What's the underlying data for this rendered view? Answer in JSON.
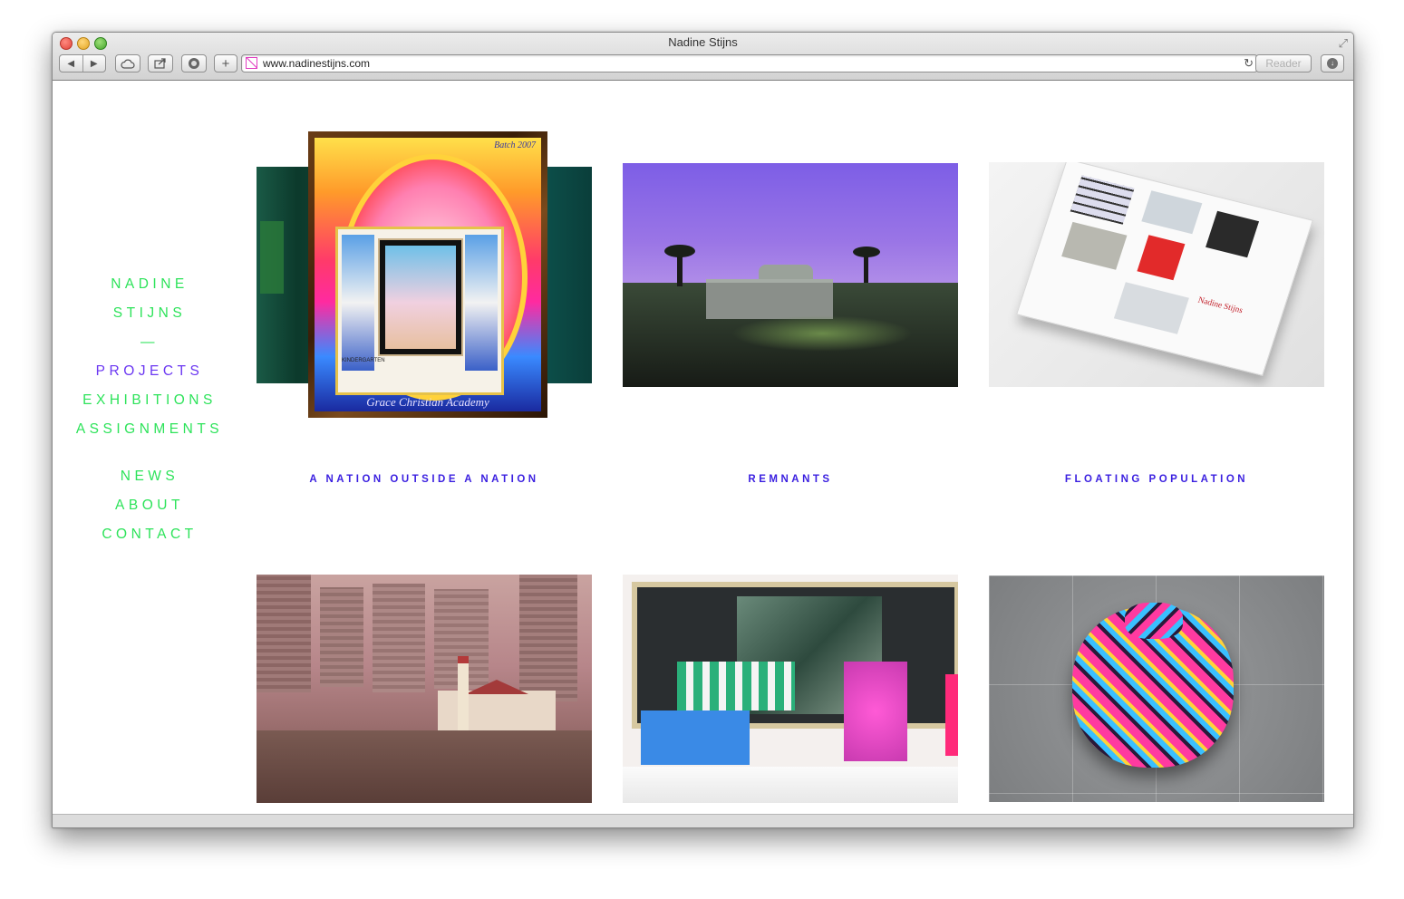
{
  "window": {
    "title": "Nadine Stijns"
  },
  "toolbar": {
    "url": "www.nadinestijns.com",
    "reader_label": "Reader",
    "back_glyph": "◀",
    "forward_glyph": "▶",
    "add_glyph": "+",
    "reload_glyph": "↻",
    "download_glyph": "↓",
    "fullscreen_glyph": "⤢"
  },
  "sidebar": {
    "name_first": "NADINE",
    "name_last": "STIJNS",
    "separator": "—",
    "nav": [
      "PROJECTS",
      "EXHIBITIONS",
      "ASSIGNMENTS"
    ],
    "secondary": [
      "NEWS",
      "ABOUT",
      "CONTACT"
    ]
  },
  "projects": [
    {
      "title": "A NATION OUTSIDE A NATION",
      "photo_text_top": "Batch 2007",
      "photo_text_bottom": "Grace Christian Academy",
      "photo_label": "KINDERGARTEN"
    },
    {
      "title": "REMNANTS"
    },
    {
      "title": "FLOATING POPULATION",
      "book_text": "Nadine Stijns"
    },
    {
      "title": ""
    },
    {
      "title": ""
    },
    {
      "title": ""
    }
  ],
  "colors": {
    "accent_green": "#2de35a",
    "accent_purple": "#6b37f2",
    "caption_blue": "#3a1fe0"
  }
}
